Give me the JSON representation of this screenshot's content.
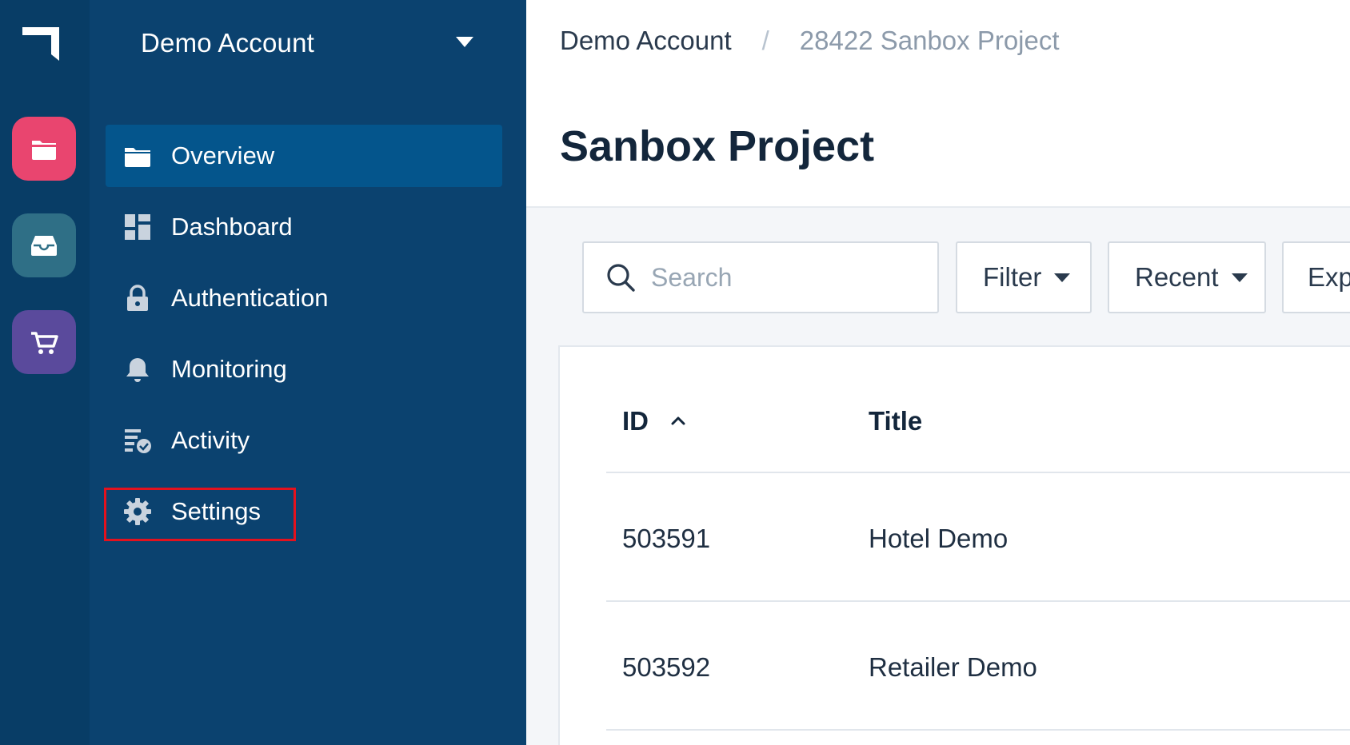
{
  "rail": {
    "apps": [
      {
        "icon": "folder-icon",
        "color": "#e9456f"
      },
      {
        "icon": "inbox-icon",
        "color": "#2f6f86"
      },
      {
        "icon": "cart-icon",
        "color": "#5a4a9c"
      }
    ]
  },
  "sidebar": {
    "account_name": "Demo Account",
    "items": [
      {
        "label": "Overview",
        "icon": "folder-icon",
        "active": true
      },
      {
        "label": "Dashboard",
        "icon": "dashboard-icon"
      },
      {
        "label": "Authentication",
        "icon": "lock-icon"
      },
      {
        "label": "Monitoring",
        "icon": "bell-icon"
      },
      {
        "label": "Activity",
        "icon": "activity-icon"
      },
      {
        "label": "Settings",
        "icon": "gear-icon",
        "highlighted": true
      }
    ]
  },
  "header": {
    "breadcrumb_root": "Demo Account",
    "breadcrumb_separator": "/",
    "breadcrumb_current": "28422 Sanbox Project",
    "title": "Sanbox Project"
  },
  "toolbar": {
    "search_placeholder": "Search",
    "filter_label": "Filter",
    "recent_label": "Recent",
    "export_label": "Exp"
  },
  "table": {
    "columns": [
      "ID",
      "Title"
    ],
    "sort_column": "ID",
    "sort_direction": "ascending",
    "rows": [
      {
        "id": "503591",
        "title": "Hotel Demo"
      },
      {
        "id": "503592",
        "title": "Retailer Demo"
      }
    ]
  },
  "colors": {
    "rail_bg": "#083d66",
    "sidebar_bg": "#0b426f",
    "active_item_bg": "#04558c",
    "highlight_border": "#e3121e"
  }
}
